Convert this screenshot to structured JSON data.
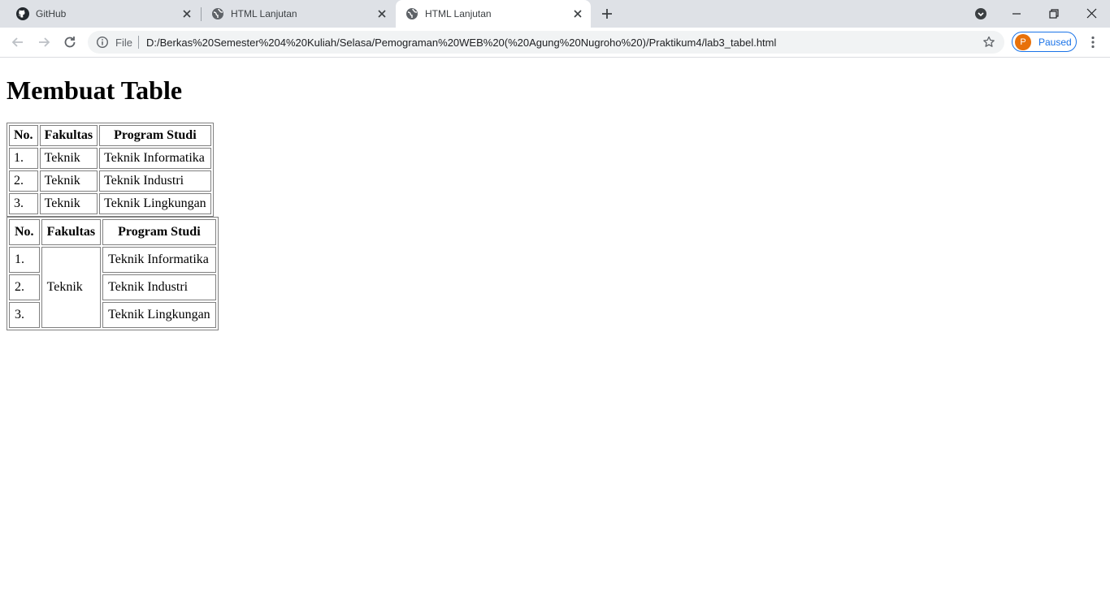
{
  "browser": {
    "tabs": [
      {
        "title": "GitHub",
        "icon": "github-icon",
        "active": false
      },
      {
        "title": "HTML Lanjutan",
        "icon": "globe-icon",
        "active": false
      },
      {
        "title": "HTML Lanjutan",
        "icon": "globe-icon",
        "active": true
      }
    ],
    "address": {
      "scheme_label": "File",
      "url": "D:/Berkas%20Semester%204%20Kuliah/Selasa/Pemograman%20WEB%20(%20Agung%20Nugroho%20)/Praktikum4/lab3_tabel.html"
    },
    "profile": {
      "initial": "P",
      "status": "Paused",
      "color": "#e8710a"
    },
    "accent": "#1a73e8"
  },
  "page": {
    "heading": "Membuat Table",
    "table1": {
      "headers": [
        "No.",
        "Fakultas",
        "Program Studi"
      ],
      "rows": [
        [
          "1.",
          "Teknik",
          "Teknik Informatika"
        ],
        [
          "2.",
          "Teknik",
          "Teknik Industri"
        ],
        [
          "3.",
          "Teknik",
          "Teknik Lingkungan"
        ]
      ]
    },
    "table2": {
      "headers": [
        "No.",
        "Fakultas",
        "Program Studi"
      ],
      "fakultas_merged": "Teknik",
      "rows": [
        [
          "1.",
          "Teknik Informatika"
        ],
        [
          "2.",
          "Teknik Industri"
        ],
        [
          "3.",
          "Teknik Lingkungan"
        ]
      ]
    }
  }
}
